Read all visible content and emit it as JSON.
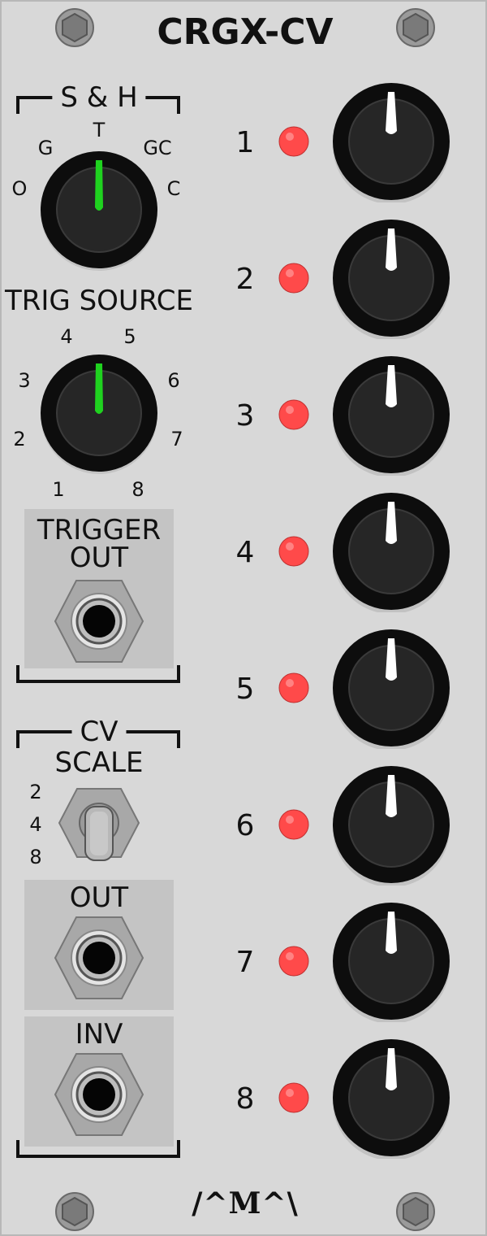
{
  "module": {
    "title": "CRGX-CV",
    "logo_text": "/^M^\\"
  },
  "sample_hold": {
    "header": "S & H",
    "positions": {
      "o": "O",
      "g": "G",
      "t": "T",
      "gc": "GC",
      "c": "C"
    },
    "label": "TRIG SOURCE",
    "knob_icon": "selector-knob-icon",
    "indicator_color": "#1fd21f"
  },
  "trig_source": {
    "positions": {
      "p1": "1",
      "p2": "2",
      "p3": "3",
      "p4": "4",
      "p5": "5",
      "p6": "6",
      "p7": "7",
      "p8": "8"
    },
    "indicator_color": "#1fd21f"
  },
  "trigger_out": {
    "label_line1": "TRIGGER",
    "label_line2": "OUT"
  },
  "cv_scale": {
    "header": "CV",
    "label": "SCALE",
    "options": [
      "2",
      "4",
      "8"
    ]
  },
  "out": {
    "label": "OUT"
  },
  "inv": {
    "label": "INV"
  },
  "channels": [
    {
      "number": "1",
      "led_color": "#ff4a4a"
    },
    {
      "number": "2",
      "led_color": "#ff4a4a"
    },
    {
      "number": "3",
      "led_color": "#ff4a4a"
    },
    {
      "number": "4",
      "led_color": "#ff4a4a"
    },
    {
      "number": "5",
      "led_color": "#ff4a4a"
    },
    {
      "number": "6",
      "led_color": "#ff4a4a"
    },
    {
      "number": "7",
      "led_color": "#ff4a4a"
    },
    {
      "number": "8",
      "led_color": "#ff4a4a"
    }
  ],
  "colors": {
    "panel": "#d8d8d8",
    "knob_pointer": "#ffffff",
    "led": "#ff4a4a"
  }
}
